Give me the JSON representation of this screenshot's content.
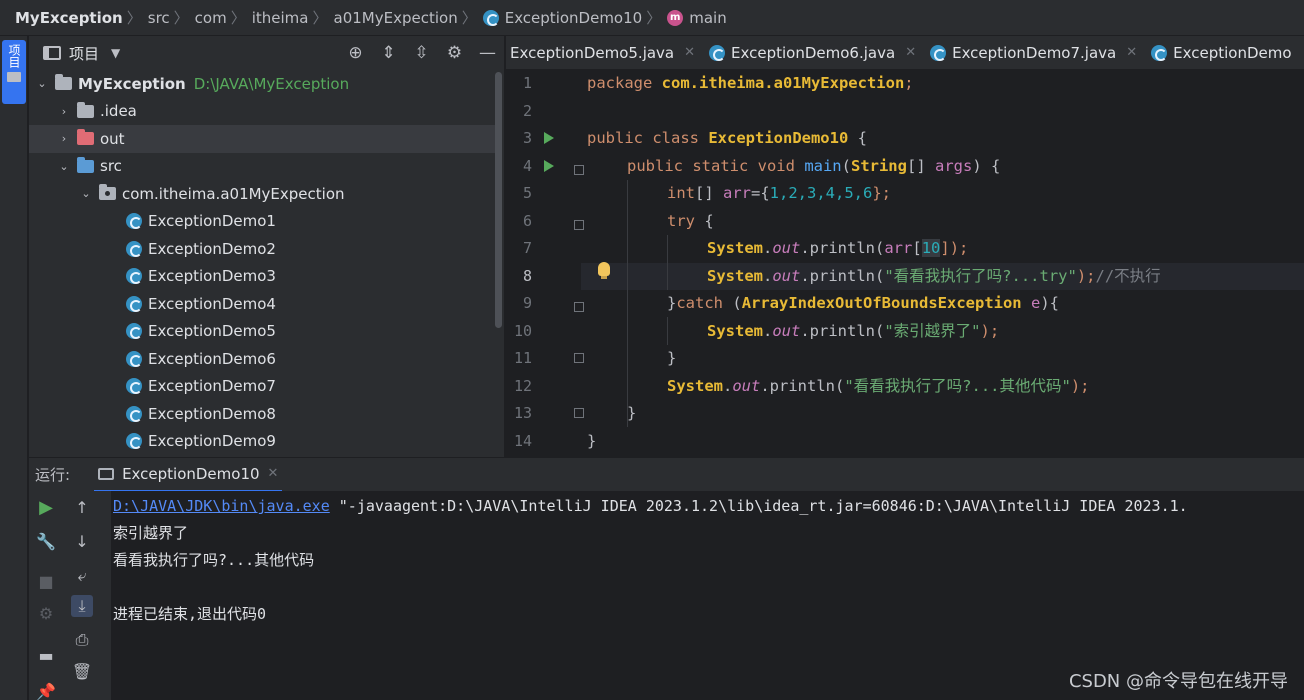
{
  "breadcrumb": {
    "project": "MyException",
    "items": [
      "src",
      "com",
      "itheima",
      "a01MyExpection"
    ],
    "class_name": "ExceptionDemo10",
    "method": "main"
  },
  "left_strip": {
    "project_tab_label": "项目"
  },
  "project_panel": {
    "title": "项目",
    "root": {
      "name": "MyException",
      "path": "D:\\JAVA\\MyException"
    },
    "tree": [
      {
        "label": ".idea",
        "kind": "folder",
        "expanded": false
      },
      {
        "label": "out",
        "kind": "folder-excluded",
        "expanded": false
      },
      {
        "label": "src",
        "kind": "folder-source",
        "expanded": true
      },
      {
        "label": "com.itheima.a01MyExpection",
        "kind": "package",
        "expanded": true
      },
      {
        "label": "ExceptionDemo1",
        "kind": "class"
      },
      {
        "label": "ExceptionDemo2",
        "kind": "class"
      },
      {
        "label": "ExceptionDemo3",
        "kind": "class"
      },
      {
        "label": "ExceptionDemo4",
        "kind": "class"
      },
      {
        "label": "ExceptionDemo5",
        "kind": "class"
      },
      {
        "label": "ExceptionDemo6",
        "kind": "class"
      },
      {
        "label": "ExceptionDemo7",
        "kind": "class"
      },
      {
        "label": "ExceptionDemo8",
        "kind": "class"
      },
      {
        "label": "ExceptionDemo9",
        "kind": "class"
      }
    ]
  },
  "editor_tabs": [
    {
      "label": "ExceptionDemo5.java"
    },
    {
      "label": "ExceptionDemo6.java"
    },
    {
      "label": "ExceptionDemo7.java"
    },
    {
      "label": "ExceptionDemo"
    }
  ],
  "editor": {
    "line_numbers": [
      "1",
      "2",
      "3",
      "4",
      "5",
      "6",
      "7",
      "8",
      "9",
      "10",
      "11",
      "12",
      "13",
      "14"
    ],
    "current_line": 8,
    "code": {
      "l1_kw": "package ",
      "l1_pkg": "com.itheima.a01MyExpection",
      "l1_end": ";",
      "l3_kw": "public class ",
      "l3_cls": "ExceptionDemo10",
      "l3_end": " {",
      "l4_kw": "public static void ",
      "l4_fn": "main",
      "l4_par": "(",
      "l4_type": "String",
      "l4_arr": "[] ",
      "l4_arg": "args",
      "l4_end": ") {",
      "l5_kw": "int",
      "l5_mid": "[] ",
      "l5_var": "arr",
      "l5_eq": "={",
      "l5_vals": "1,2,3,4,5,6",
      "l5_end": "};",
      "l6_kw": "try",
      "l6_end": " {",
      "l7_sys": "System",
      "l7_dot": ".",
      "l7_out": "out",
      "l7_call": ".println(",
      "l7_arr": "arr",
      "l7_br": "[",
      "l7_idx": "10",
      "l7_end": "]);",
      "l8_sys": "System",
      "l8_dot": ".",
      "l8_out": "out",
      "l8_call": ".println(",
      "l8_str": "\"看看我执行了吗?...try\"",
      "l8_end": ");",
      "l8_cmt": "//不执行",
      "l9_brace": "}",
      "l9_kw": "catch",
      "l9_sp": " (",
      "l9_cls": "ArrayIndexOutOfBoundsException",
      "l9_var": " e",
      "l9_end": "){",
      "l10_sys": "System",
      "l10_dot": ".",
      "l10_out": "out",
      "l10_call": ".println(",
      "l10_str": "\"索引越界了\"",
      "l10_end": ");",
      "l11": "}",
      "l12_sys": "System",
      "l12_dot": ".",
      "l12_out": "out",
      "l12_call": ".println(",
      "l12_str": "\"看看我执行了吗?...其他代码\"",
      "l12_end": ");",
      "l13": "}",
      "l14": "}"
    }
  },
  "run": {
    "label": "运行:",
    "tab": "ExceptionDemo10",
    "console": {
      "java_link": "D:\\JAVA\\JDK\\bin\\java.exe",
      "java_args": " \"-javaagent:D:\\JAVA\\IntelliJ IDEA 2023.1.2\\lib\\idea_rt.jar=60846:D:\\JAVA\\IntelliJ IDEA 2023.1.",
      "out1": "索引越界了",
      "out2": "看看我执行了吗?...其他代码",
      "out3": "",
      "exit": "进程已结束,退出代码0"
    }
  },
  "watermark": "CSDN @命令导包在线开导"
}
